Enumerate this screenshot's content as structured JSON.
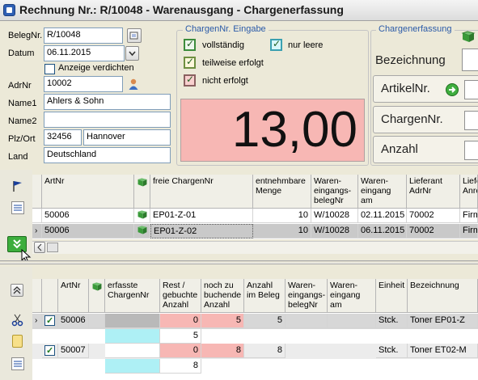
{
  "window": {
    "title": "Rechnung Nr.: R/10048 - Warenausgang - Chargenerfassung"
  },
  "form": {
    "belegnr_label": "BelegNr.",
    "belegnr_value": "R/10048",
    "datum_label": "Datum",
    "datum_value": "06.11.2015",
    "anzeige_label": "Anzeige verdichten",
    "adrnr_label": "AdrNr",
    "adrnr_value": "10002",
    "name1_label": "Name1",
    "name1_value": "Ahlers & Sohn",
    "name2_label": "Name2",
    "name2_value": "",
    "plzort_label": "Plz/Ort",
    "plz_value": "32456",
    "ort_value": "Hannover",
    "land_label": "Land",
    "land_value": "Deutschland"
  },
  "legend": {
    "title": "ChargenNr. Eingabe",
    "items": {
      "complete": "vollständig",
      "partial": "teilweise erfolgt",
      "none": "nicht erfolgt",
      "empty_only": "nur leere"
    }
  },
  "display": {
    "value": "13,00"
  },
  "right_group": {
    "title": "Chargenerfassung",
    "fields": {
      "bezeichnung": "Bezeichnung",
      "artikelnr": "ArtikelNr.",
      "chargennr": "ChargenNr.",
      "anzahl": "Anzahl"
    }
  },
  "upper_grid": {
    "headers": {
      "artnr": "ArtNr",
      "chargen": "freie ChargenNr",
      "menge": "entnehmbare Menge",
      "belegnr": "Waren-eingangs-belegNr",
      "am": "Waren-eingang am",
      "lieferant": "Lieferant AdrNr",
      "liefanr": "Liefe Anre"
    },
    "rows": [
      {
        "artnr": "50006",
        "charge": "EP01-Z-01",
        "menge": "10",
        "belegnr": "W/10028",
        "am": "02.11.2015",
        "lieferant": "70002",
        "firma": "Firm"
      },
      {
        "artnr": "50006",
        "charge": "EP01-Z-02",
        "menge": "10",
        "belegnr": "W/10028",
        "am": "06.11.2015",
        "lieferant": "70002",
        "firma": "Firm"
      }
    ]
  },
  "lower_grid": {
    "headers": {
      "artnr": "ArtNr",
      "charge": "erfasste ChargenNr",
      "rest": "Rest / gebuchte Anzahl",
      "noch": "noch zu buchende Anzahl",
      "anzahl": "Anzahl im Beleg",
      "belegnr": "Waren-eingangs-belegNr",
      "am": "Waren-eingang am",
      "einheit": "Einheit",
      "bez": "Bezeichnung"
    },
    "rows": [
      {
        "artnr": "50006",
        "rest": "0",
        "noch": "5",
        "anzahl": "5",
        "einheit": "Stck.",
        "bez": "Toner EP01-Z",
        "sub": "5"
      },
      {
        "artnr": "50007",
        "rest": "0",
        "noch": "8",
        "anzahl": "8",
        "einheit": "Stck.",
        "bez": "Toner ET02-M",
        "sub": "8"
      }
    ]
  },
  "colors": {
    "display_bg": "#f7b7b4",
    "selected_row": "#c9c9c9",
    "cyan_cell": "#aef0f5",
    "pink_cell": "#f7b7b4"
  }
}
